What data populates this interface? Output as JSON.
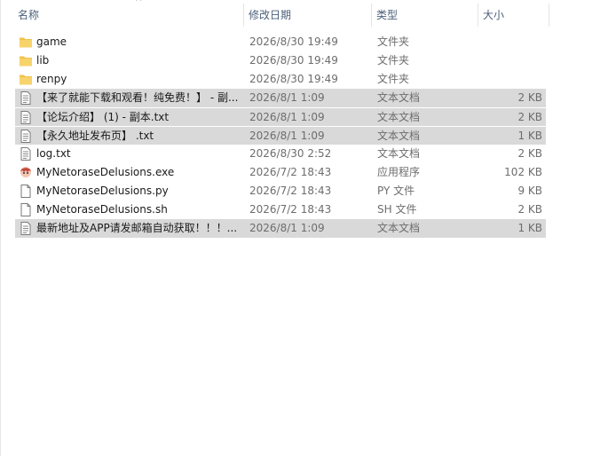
{
  "header": {
    "name": "名称",
    "date": "修改日期",
    "type": "类型",
    "size": "大小",
    "sort_indicator": "^"
  },
  "files": [
    {
      "name": "game",
      "date": "2026/8/30 19:49",
      "type": "文件夹",
      "size": "",
      "icon": "folder-icon",
      "selected": false
    },
    {
      "name": "lib",
      "date": "2026/8/30 19:49",
      "type": "文件夹",
      "size": "",
      "icon": "folder-icon",
      "selected": false
    },
    {
      "name": "renpy",
      "date": "2026/8/30 19:49",
      "type": "文件夹",
      "size": "",
      "icon": "folder-icon",
      "selected": false
    },
    {
      "name": "【来了就能下载和观看！纯免费！】 - 副...",
      "date": "2026/8/1 1:09",
      "type": "文本文档",
      "size": "2 KB",
      "icon": "text-document-icon",
      "selected": true
    },
    {
      "name": "【论坛介绍】 (1) - 副本.txt",
      "date": "2026/8/1 1:09",
      "type": "文本文档",
      "size": "2 KB",
      "icon": "text-document-icon",
      "selected": true
    },
    {
      "name": "【永久地址发布页】 .txt",
      "date": "2026/8/1 1:09",
      "type": "文本文档",
      "size": "1 KB",
      "icon": "text-document-icon",
      "selected": true
    },
    {
      "name": "log.txt",
      "date": "2026/8/30 2:52",
      "type": "文本文档",
      "size": "2 KB",
      "icon": "text-document-icon",
      "selected": false
    },
    {
      "name": "MyNetoraseDelusions.exe",
      "date": "2026/7/2 18:43",
      "type": "应用程序",
      "size": "102 KB",
      "icon": "application-icon",
      "selected": false
    },
    {
      "name": "MyNetoraseDelusions.py",
      "date": "2026/7/2 18:43",
      "type": "PY 文件",
      "size": "9 KB",
      "icon": "blank-file-icon",
      "selected": false
    },
    {
      "name": "MyNetoraseDelusions.sh",
      "date": "2026/7/2 18:43",
      "type": "SH 文件",
      "size": "2 KB",
      "icon": "blank-file-icon",
      "selected": false
    },
    {
      "name": "最新地址及APP请发邮箱自动获取！！！...",
      "date": "2026/8/1 1:09",
      "type": "文本文档",
      "size": "1 KB",
      "icon": "text-document-icon",
      "selected": true
    }
  ],
  "colors": {
    "selection": "#d9d9d9",
    "header_text": "#4c607a",
    "folder": "#f0c24a"
  }
}
